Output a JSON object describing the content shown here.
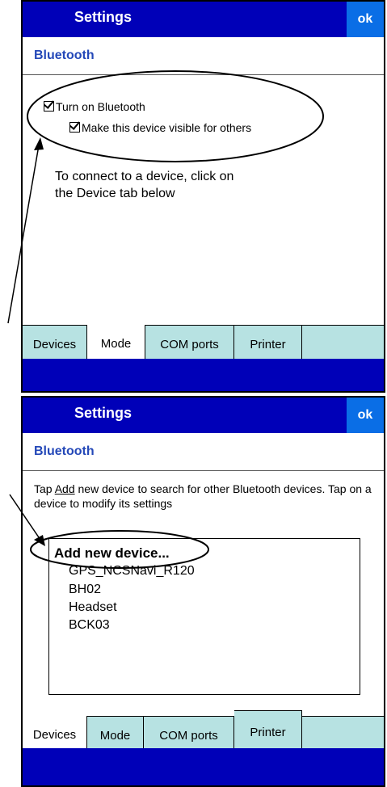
{
  "screen1": {
    "title": "Settings",
    "ok_label": "ok",
    "subtitle": "Bluetooth",
    "options": [
      {
        "label": "Turn on Bluetooth",
        "checked": true
      },
      {
        "label": "Make this device visible for others",
        "checked": true
      }
    ],
    "help_text": "To connect to a device, click on the Device tab below",
    "tabs": [
      "Devices",
      "Mode",
      "COM ports",
      "Printer"
    ],
    "active_tab": "Mode"
  },
  "screen2": {
    "title": "Settings",
    "ok_label": "ok",
    "subtitle": "Bluetooth",
    "help_before": "Tap ",
    "help_link": "Add",
    "help_after": " new device to search for other Bluetooth devices. Tap on a device to modify its settings",
    "add_device": "Add new device...",
    "devices": [
      "GPS_NCSNavi_R120",
      "BH02",
      "Headset",
      "BCK03"
    ],
    "tabs": [
      "Devices",
      "Mode",
      "COM ports",
      "Printer"
    ],
    "active_tab": "Devices"
  },
  "colors": {
    "titlebar": "#0000b8",
    "ok": "#0a6ee6",
    "subtitle": "#2448b8",
    "tab": "#b7e2e2"
  }
}
